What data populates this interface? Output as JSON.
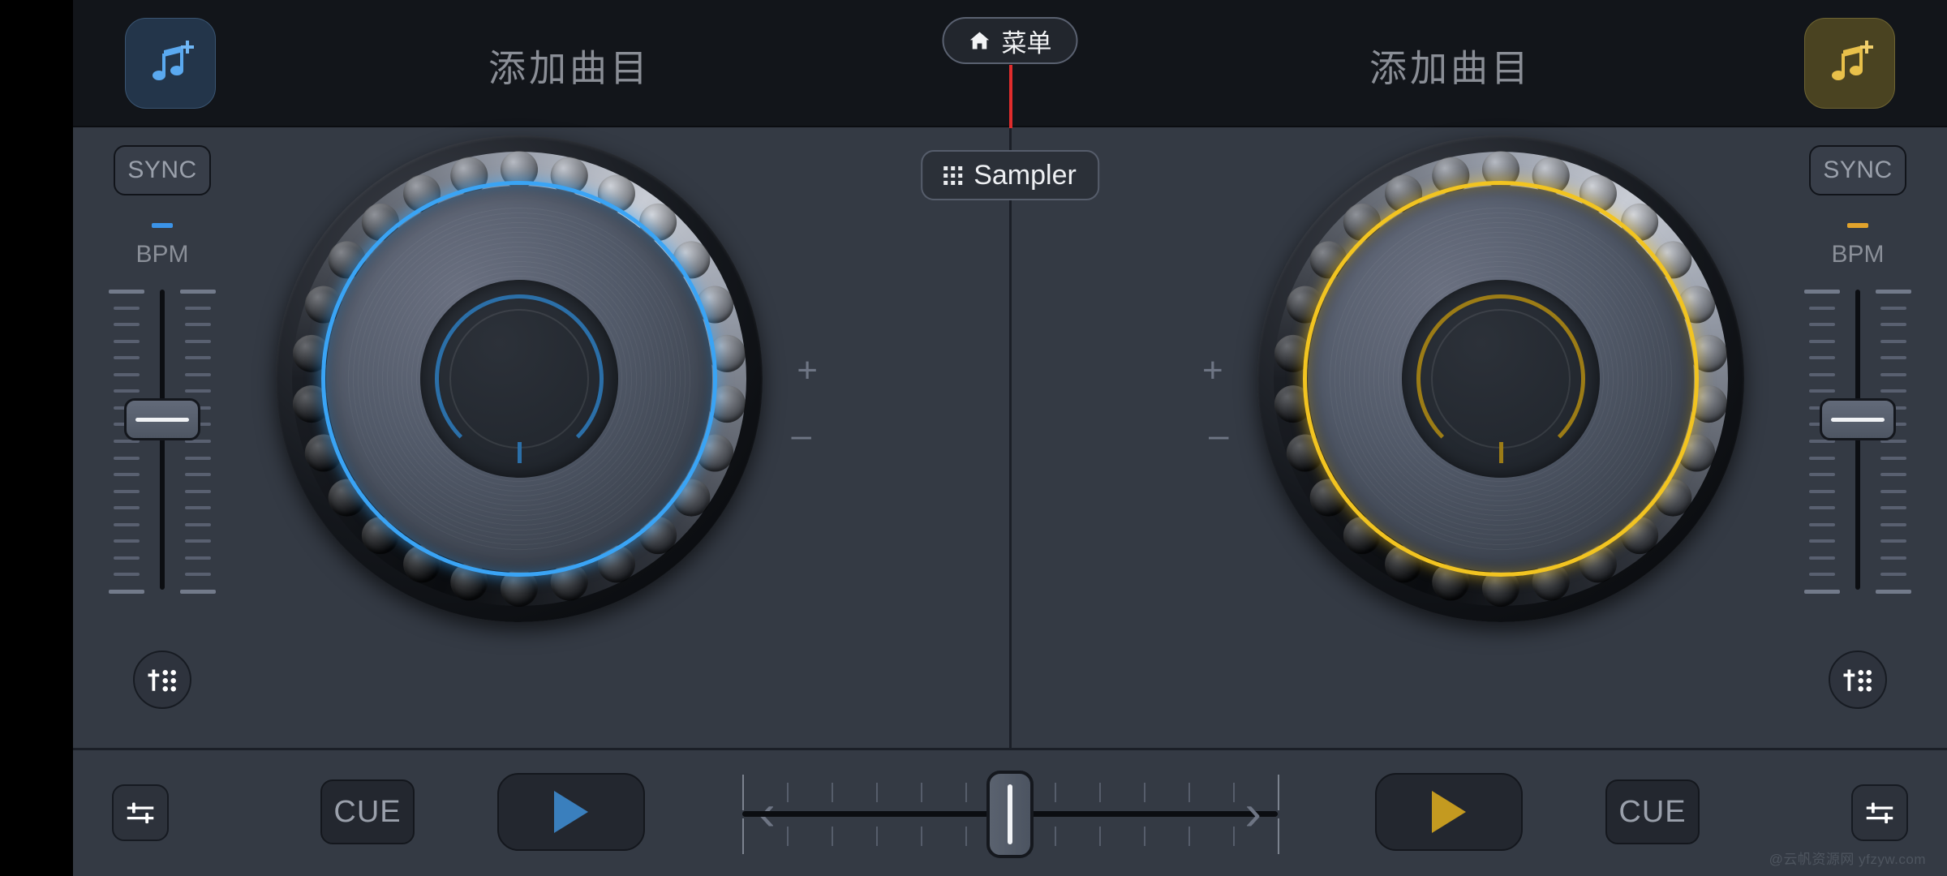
{
  "theme": {
    "bg": "#343a44",
    "topbar_bg": "#12151a",
    "deck_a_accent": "#3aa4f5",
    "deck_b_accent": "#f2c421",
    "text_muted": "#8a8f98",
    "marker_red": "#e02c2c"
  },
  "topbar": {
    "load_left": {
      "label": "添加曲目",
      "icon": "music-note-plus-icon",
      "accent": "#5aa9f0"
    },
    "load_right": {
      "label": "添加曲目",
      "icon": "music-note-plus-icon",
      "accent": "#e8c04a"
    },
    "menu_button": {
      "label": "菜单",
      "icon": "home-icon"
    }
  },
  "sampler": {
    "label": "Sampler",
    "icon": "grid-3x3-icon"
  },
  "deck_a": {
    "sync_label": "SYNC",
    "bpm_label": "BPM",
    "bpm_value": "—",
    "accent": "#3aa4f5",
    "pitch_plus": "+",
    "pitch_minus": "–",
    "pad_icon": "pads-icon",
    "eq_icon": "eq-sliders-icon",
    "cue_label": "CUE",
    "play_icon": "play-icon"
  },
  "deck_b": {
    "sync_label": "SYNC",
    "bpm_label": "BPM",
    "bpm_value": "—",
    "accent": "#f2c421",
    "pitch_plus": "+",
    "pitch_minus": "–",
    "pad_icon": "pads-icon",
    "eq_icon": "eq-sliders-icon",
    "cue_label": "CUE",
    "play_icon": "play-icon"
  },
  "crossfader": {
    "left_arrow": "‹",
    "right_arrow": "›",
    "position_percent": 50
  },
  "watermark": {
    "text": "@云帆资源网 yfzyw.com"
  }
}
